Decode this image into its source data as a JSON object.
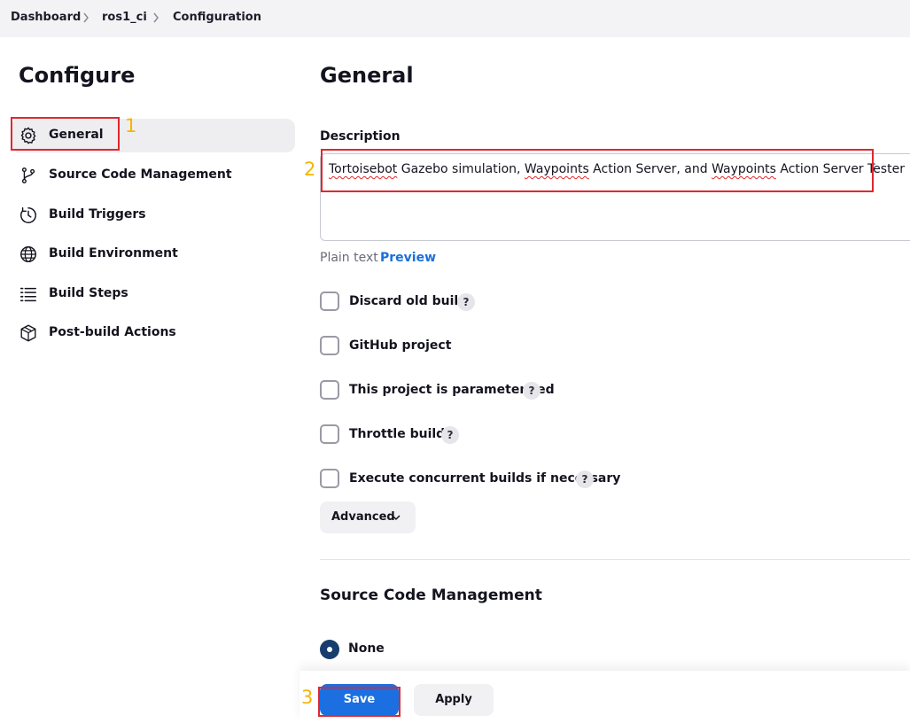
{
  "breadcrumb": {
    "items": [
      "Dashboard",
      "ros1_ci",
      "Configuration"
    ]
  },
  "sidebar": {
    "title": "Configure",
    "items": [
      {
        "label": "General",
        "icon": "gear-icon",
        "active": true
      },
      {
        "label": "Source Code Management",
        "icon": "branch-icon"
      },
      {
        "label": "Build Triggers",
        "icon": "clock-icon"
      },
      {
        "label": "Build Environment",
        "icon": "globe-icon"
      },
      {
        "label": "Build Steps",
        "icon": "list-icon"
      },
      {
        "label": "Post-build Actions",
        "icon": "package-icon"
      }
    ]
  },
  "main": {
    "title": "General",
    "description": {
      "label": "Description",
      "value_parts": [
        "Tortoisebot",
        " Gazebo simulation, ",
        "Waypoints",
        " Action Server, and ",
        "Waypoints",
        " Action Server Tester"
      ],
      "format": "Plain text",
      "preview": "Preview"
    },
    "options": [
      {
        "label": "Discard old builds",
        "checked": false,
        "help": "?"
      },
      {
        "label": "GitHub project",
        "checked": false
      },
      {
        "label": "This project is parameterized",
        "checked": false,
        "help": "?"
      },
      {
        "label": "Throttle builds",
        "checked": false,
        "help": "?"
      },
      {
        "label": "Execute concurrent builds if necessary",
        "checked": false,
        "help": "?"
      }
    ],
    "advanced": "Advanced",
    "scm": {
      "title": "Source Code Management",
      "selected": "None"
    }
  },
  "footer": {
    "save": "Save",
    "apply": "Apply"
  },
  "annotations": [
    "1",
    "2",
    "3"
  ],
  "colors": {
    "accent": "#1b6fe0",
    "annotation_box": "#e0282e",
    "annotation_number": "#f5b400",
    "radio_selected": "#163d6b"
  }
}
